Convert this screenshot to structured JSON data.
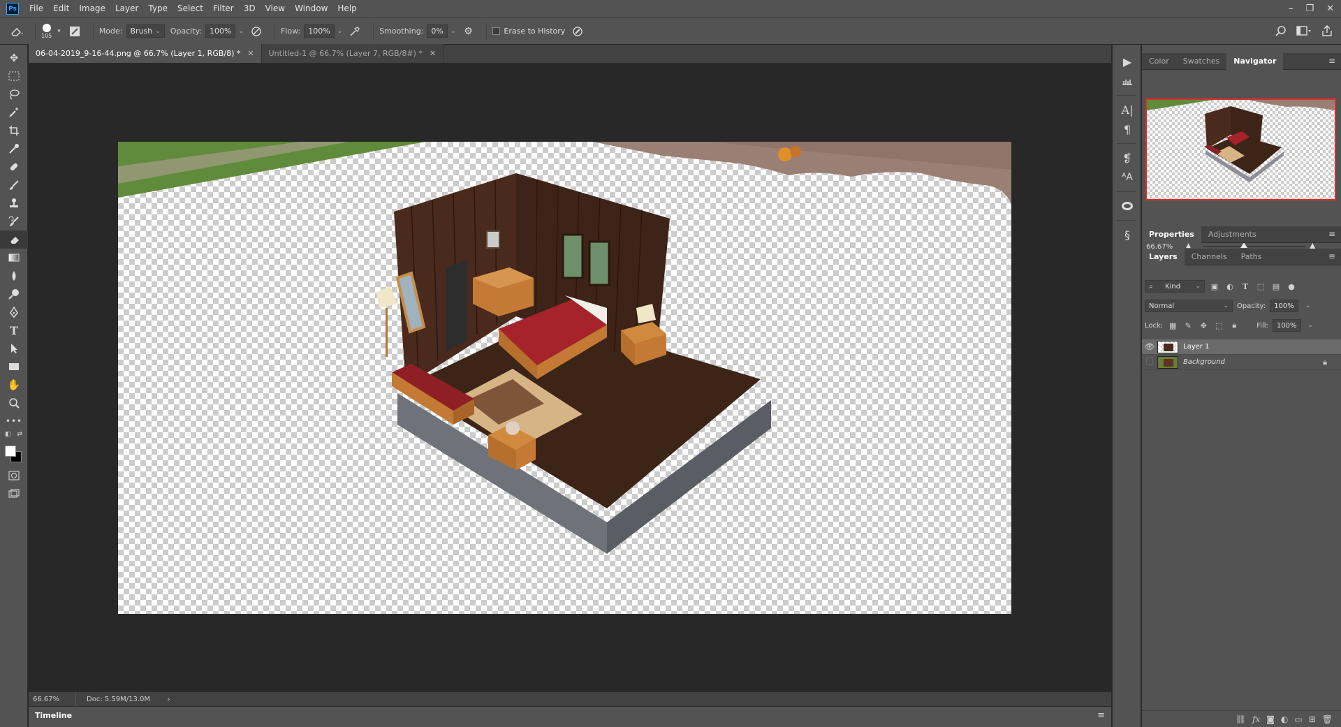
{
  "app": {
    "logo": "Ps",
    "menu": [
      "File",
      "Edit",
      "Image",
      "Layer",
      "Type",
      "Select",
      "Filter",
      "3D",
      "View",
      "Window",
      "Help"
    ],
    "window_controls": {
      "minimize": "–",
      "restore": "❐",
      "close": "✕"
    }
  },
  "options": {
    "brush_size": "105",
    "mode_label": "Mode:",
    "mode_value": "Brush",
    "opacity_label": "Opacity:",
    "opacity_value": "100%",
    "flow_label": "Flow:",
    "flow_value": "100%",
    "smoothing_label": "Smoothing:",
    "smoothing_value": "0%",
    "erase_history_label": "Erase to History",
    "erase_history_checked": false
  },
  "tools": [
    "move-tool",
    "marquee-tool",
    "lasso-tool",
    "magic-wand-tool",
    "crop-tool",
    "eyedropper-tool",
    "healing-brush-tool",
    "brush-tool",
    "clone-stamp-tool",
    "history-brush-tool",
    "eraser-tool",
    "gradient-tool",
    "blur-tool",
    "dodge-tool",
    "pen-tool",
    "type-tool",
    "path-selection-tool",
    "rectangle-tool",
    "hand-tool",
    "zoom-tool",
    "more-tools"
  ],
  "active_tool": "eraser-tool",
  "colors": {
    "foreground": "#ffffff",
    "background": "#000000"
  },
  "documents": {
    "tabs": [
      {
        "label": "06-04-2019_9-16-44.png @ 66.7% (Layer 1, RGB/8) *",
        "active": true
      },
      {
        "label": "Untitled-1 @ 66.7% (Layer 7, RGB/8#) *",
        "active": false
      }
    ],
    "close_glyph": "✕"
  },
  "status": {
    "zoom": "66.67%",
    "doc": "Doc: 5.59M/13.0M",
    "arrow": "›"
  },
  "timeline": {
    "label": "Timeline",
    "menu": "≡"
  },
  "panels": {
    "top_tabs": [
      {
        "label": "Color",
        "active": false
      },
      {
        "label": "Swatches",
        "active": false
      },
      {
        "label": "Navigator",
        "active": true
      }
    ],
    "navigator_zoom": "66.67%",
    "navigator_zoom_fraction": 0.4,
    "props_tabs": [
      {
        "label": "Properties",
        "active": true
      },
      {
        "label": "Adjustments",
        "active": false
      }
    ],
    "layers_tabs": [
      {
        "label": "Layers",
        "active": true
      },
      {
        "label": "Channels",
        "active": false
      },
      {
        "label": "Paths",
        "active": false
      }
    ],
    "kind_label": "Kind",
    "blend_mode": "Normal",
    "opacity_label": "Opacity:",
    "opacity_value": "100%",
    "lock_label": "Lock:",
    "fill_label": "Fill:",
    "fill_value": "100%",
    "layers": [
      {
        "name": "Layer 1",
        "visible": true,
        "selected": true,
        "italic": false
      },
      {
        "name": "Background",
        "visible": false,
        "selected": false,
        "italic": true
      }
    ]
  },
  "accent": {
    "navigator_border": "#e02b2b",
    "selection": "#6b6b6b"
  }
}
